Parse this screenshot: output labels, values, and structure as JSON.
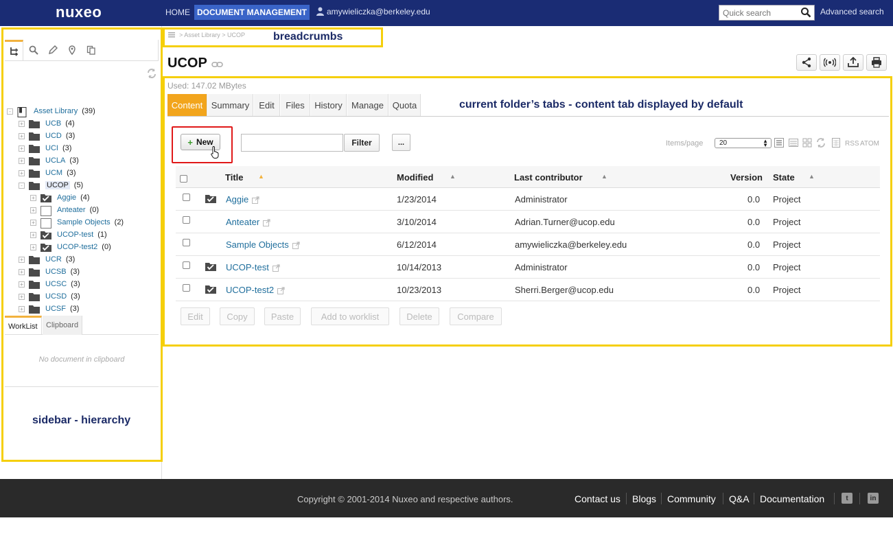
{
  "header": {
    "logo": "nuxeo",
    "nav": {
      "home": "HOME",
      "document_management": "DOCUMENT MANAGEMENT"
    },
    "user": "amywieliczka@berkeley.edu",
    "search_placeholder": "Quick search",
    "advanced_search": "Advanced search"
  },
  "annotations": {
    "breadcrumbs": "breadcrumbs",
    "tabs": "current folder’s tabs - content tab displayed by default",
    "sidebar": "sidebar - hierarchy"
  },
  "sidebar": {
    "tabs": [
      "tree-icon",
      "search-icon",
      "tag-icon",
      "location-icon",
      "copy-icon"
    ],
    "tree": [
      {
        "label": "Asset Library",
        "count": "(39)",
        "level": 0,
        "expander": "-",
        "icon": "library-icon"
      },
      {
        "label": "UCB",
        "count": "(4)",
        "level": 1,
        "expander": "+",
        "icon": "folder-icon"
      },
      {
        "label": "UCD",
        "count": "(3)",
        "level": 1,
        "expander": "+",
        "icon": "folder-icon"
      },
      {
        "label": "UCI",
        "count": "(3)",
        "level": 1,
        "expander": "+",
        "icon": "folder-icon"
      },
      {
        "label": "UCLA",
        "count": "(3)",
        "level": 1,
        "expander": "+",
        "icon": "folder-icon"
      },
      {
        "label": "UCM",
        "count": "(3)",
        "level": 1,
        "expander": "+",
        "icon": "folder-icon"
      },
      {
        "label": "UCOP",
        "count": "(5)",
        "level": 1,
        "expander": "-",
        "icon": "folder-icon",
        "selected": true
      },
      {
        "label": "Aggie",
        "count": "(4)",
        "level": 2,
        "expander": "+",
        "icon": "checked-folder-icon"
      },
      {
        "label": "Anteater",
        "count": "(0)",
        "level": 2,
        "expander": "+",
        "icon": "empty-folder-icon"
      },
      {
        "label": "Sample Objects",
        "count": "(2)",
        "level": 2,
        "expander": "+",
        "icon": "empty-folder-icon"
      },
      {
        "label": "UCOP-test",
        "count": "(1)",
        "level": 2,
        "expander": "+",
        "icon": "checked-folder-icon"
      },
      {
        "label": "UCOP-test2",
        "count": "(0)",
        "level": 2,
        "expander": "+",
        "icon": "checked-folder-icon"
      },
      {
        "label": "UCR",
        "count": "(3)",
        "level": 1,
        "expander": "+",
        "icon": "folder-icon"
      },
      {
        "label": "UCSB",
        "count": "(3)",
        "level": 1,
        "expander": "+",
        "icon": "folder-icon"
      },
      {
        "label": "UCSC",
        "count": "(3)",
        "level": 1,
        "expander": "+",
        "icon": "folder-icon"
      },
      {
        "label": "UCSD",
        "count": "(3)",
        "level": 1,
        "expander": "+",
        "icon": "folder-icon"
      },
      {
        "label": "UCSF",
        "count": "(3)",
        "level": 1,
        "expander": "+",
        "icon": "folder-icon"
      }
    ],
    "clip_tabs": {
      "worklist": "WorkList",
      "clipboard": "Clipboard"
    },
    "clip_empty": "No document in clipboard"
  },
  "main": {
    "breadcrumb": "> Asset Library > UCOP",
    "title": "UCOP",
    "used": "Used: 147.02 MBytes",
    "actions": [
      "share-icon",
      "subscribe-icon",
      "export-icon",
      "print-icon"
    ],
    "tabs": [
      "Content",
      "Summary",
      "Edit",
      "Files",
      "History",
      "Manage",
      "Quota"
    ],
    "new_button": "New",
    "filter_placeholder": "",
    "filter_button": "Filter",
    "more_button": "...",
    "items_per_page_label": "Items/page",
    "items_per_page": "20",
    "rss": "RSS",
    "atom": "ATOM",
    "columns": {
      "title": "Title",
      "modified": "Modified",
      "last_contributor": "Last contributor",
      "version": "Version",
      "state": "State"
    },
    "rows": [
      {
        "title": "Aggie",
        "modified": "1/23/2014",
        "contributor": "Administrator",
        "version": "0.0",
        "state": "Project",
        "icon": "checked-folder-icon"
      },
      {
        "title": "Anteater",
        "modified": "3/10/2014",
        "contributor": "Adrian.Turner@ucop.edu",
        "version": "0.0",
        "state": "Project",
        "icon": ""
      },
      {
        "title": "Sample Objects",
        "modified": "6/12/2014",
        "contributor": "amywieliczka@berkeley.edu",
        "version": "0.0",
        "state": "Project",
        "icon": ""
      },
      {
        "title": "UCOP-test",
        "modified": "10/14/2013",
        "contributor": "Administrator",
        "version": "0.0",
        "state": "Project",
        "icon": "checked-folder-icon"
      },
      {
        "title": "UCOP-test2",
        "modified": "10/23/2013",
        "contributor": "Sherri.Berger@ucop.edu",
        "version": "0.0",
        "state": "Project",
        "icon": "checked-folder-icon"
      }
    ],
    "bottom_buttons": [
      "Edit",
      "Copy",
      "Paste",
      "Add to worklist",
      "Delete",
      "Compare"
    ]
  },
  "footer": {
    "copyright": "Copyright © 2001-2014 Nuxeo and respective authors.",
    "links": [
      "Contact us",
      "Blogs",
      "Community",
      "Q&A",
      "Documentation"
    ],
    "social": [
      "twitter-icon",
      "linkedin-icon"
    ]
  }
}
